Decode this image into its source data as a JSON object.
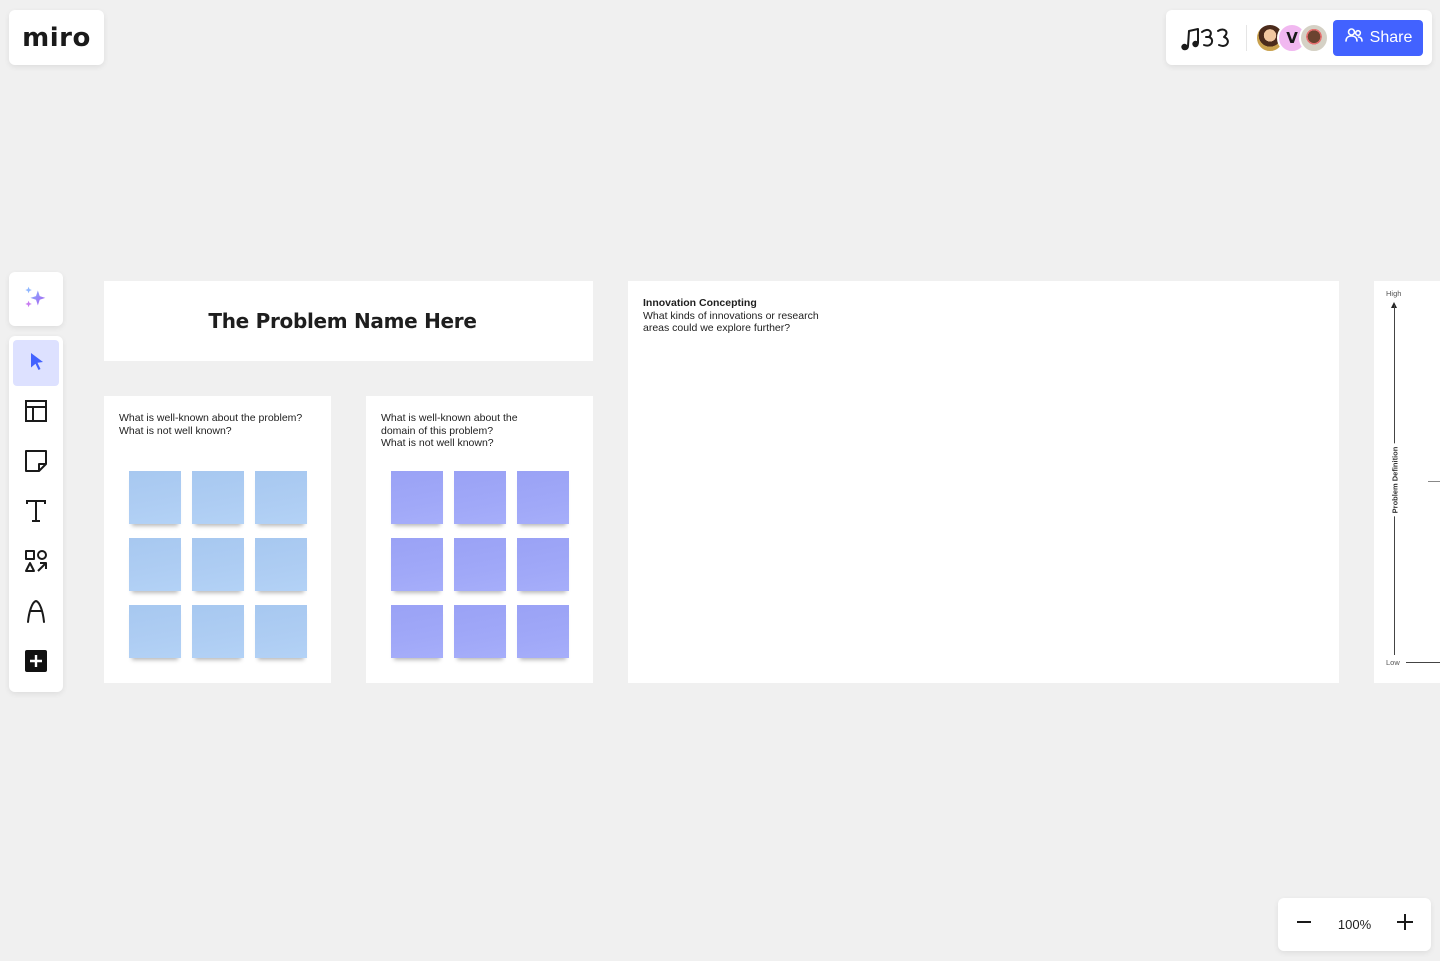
{
  "app": {
    "logo_text": "miro"
  },
  "header": {
    "board_icon": "music-notes-doodle-icon",
    "collaborators": [
      {
        "type": "photo",
        "name": "collaborator-1"
      },
      {
        "type": "initial",
        "initial": "V",
        "color": "#f1b8f0"
      },
      {
        "type": "photo",
        "name": "collaborator-3"
      }
    ],
    "share_label": "Share",
    "share_icon": "users-icon",
    "share_color": "#4262ff"
  },
  "toolbar": {
    "ai_icon": "sparkles-icon",
    "tools": [
      {
        "name": "select",
        "icon": "cursor-icon",
        "active": true
      },
      {
        "name": "templates",
        "icon": "layout-icon",
        "active": false
      },
      {
        "name": "sticky-note",
        "icon": "sticky-note-icon",
        "active": false
      },
      {
        "name": "text",
        "icon": "text-icon",
        "active": false
      },
      {
        "name": "shapes",
        "icon": "shapes-icon",
        "active": false
      },
      {
        "name": "pen",
        "icon": "pen-icon",
        "active": false
      },
      {
        "name": "more",
        "icon": "plus-square-icon",
        "active": false
      }
    ],
    "active_color": "#4262ff"
  },
  "canvas": {
    "title_frame": {
      "title": "The Problem Name Here"
    },
    "known_frame": {
      "question_lines": [
        "What is well-known about the problem?",
        "What is not well known?"
      ],
      "sticky_color": "#aecdf3",
      "sticky_count": 9
    },
    "domain_frame": {
      "question_lines": [
        "What is well-known about the",
        "domain of this problem?",
        "What is not well known?"
      ],
      "sticky_color": "#a0a8f8",
      "sticky_count": 9
    },
    "innovation_frame": {
      "title": "Innovation Concepting",
      "lines": [
        "What kinds of innovations or research",
        "areas could we explore further?"
      ]
    },
    "matrix_frame": {
      "y_high": "High",
      "y_low": "Low",
      "y_axis_label": "Problem Definition"
    }
  },
  "zoom": {
    "level": "100%",
    "zoom_out_icon": "minus-icon",
    "zoom_in_icon": "plus-icon"
  }
}
